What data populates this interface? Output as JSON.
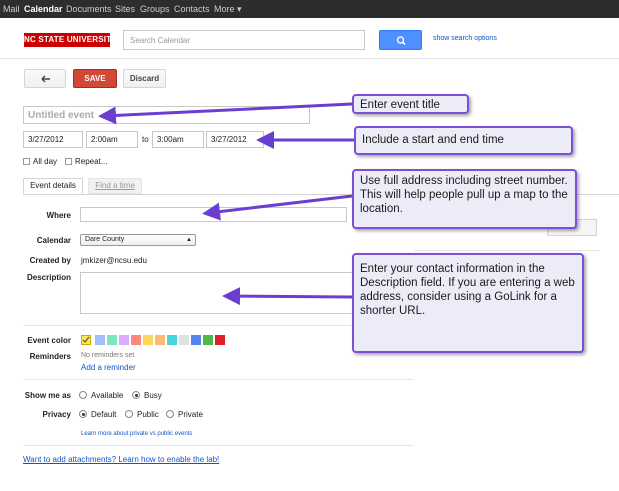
{
  "topnav": {
    "items": [
      "Mail",
      "Calendar",
      "Documents",
      "Sites",
      "Groups",
      "Contacts",
      "More ▾"
    ]
  },
  "header": {
    "logo": "NC STATE UNIVERSITY",
    "search_placeholder": "Search Calendar",
    "search_options": "show search options"
  },
  "toolbar": {
    "back_icon": "arrow-left-icon",
    "save_label": "SAVE",
    "discard_label": "Discard"
  },
  "event": {
    "title_placeholder": "Untitled event",
    "start_date": "3/27/2012",
    "start_time": "2:00am",
    "to_label": "to",
    "end_time": "3:00am",
    "end_date": "3/27/2012",
    "all_day_label": "All day",
    "repeat_label": "Repeat..."
  },
  "tabs": {
    "details": "Event details",
    "find_time": "Find a time"
  },
  "form": {
    "where_label": "Where",
    "calendar_label": "Calendar",
    "calendar_value": "Dare County",
    "created_by_label": "Created by",
    "created_by_value": "jmkizer@ncsu.edu",
    "description_label": "Description",
    "event_color_label": "Event color",
    "event_colors": [
      "#fce45c",
      "#a4bdfc",
      "#7ae7bf",
      "#dbadff",
      "#ff887c",
      "#fbd75b",
      "#ffb878",
      "#46d6db",
      "#e1e1e1",
      "#5484ed",
      "#51b749",
      "#dc2127"
    ],
    "reminders_label": "Reminders",
    "reminders_none": "No reminders set",
    "add_reminder": "Add a reminder",
    "show_me_as_label": "Show me as",
    "available_label": "Available",
    "busy_label": "Busy",
    "privacy_label": "Privacy",
    "default_label": "Default",
    "public_label": "Public",
    "private_label": "Private",
    "privacy_link": "Learn more about private vs public events",
    "attachments_link": "Want to add attachments? Learn how to enable the lab!"
  },
  "callouts": {
    "title": "Enter event title",
    "time": "Include a start and end time",
    "address": "Use full address including street number.  This will help people pull up a map to the location.",
    "contact": "Enter your contact information in the Description field.  If you are entering a web address, consider using a GoLink for a shorter URL."
  },
  "colors": {
    "nav_bg": "#2d2d2d",
    "brand_red": "#cc0000",
    "save_red": "#d14836",
    "search_blue": "#4d90fe",
    "link_blue": "#1155cc",
    "callout_border": "#7b4fd6",
    "callout_bg": "#ececf8"
  }
}
